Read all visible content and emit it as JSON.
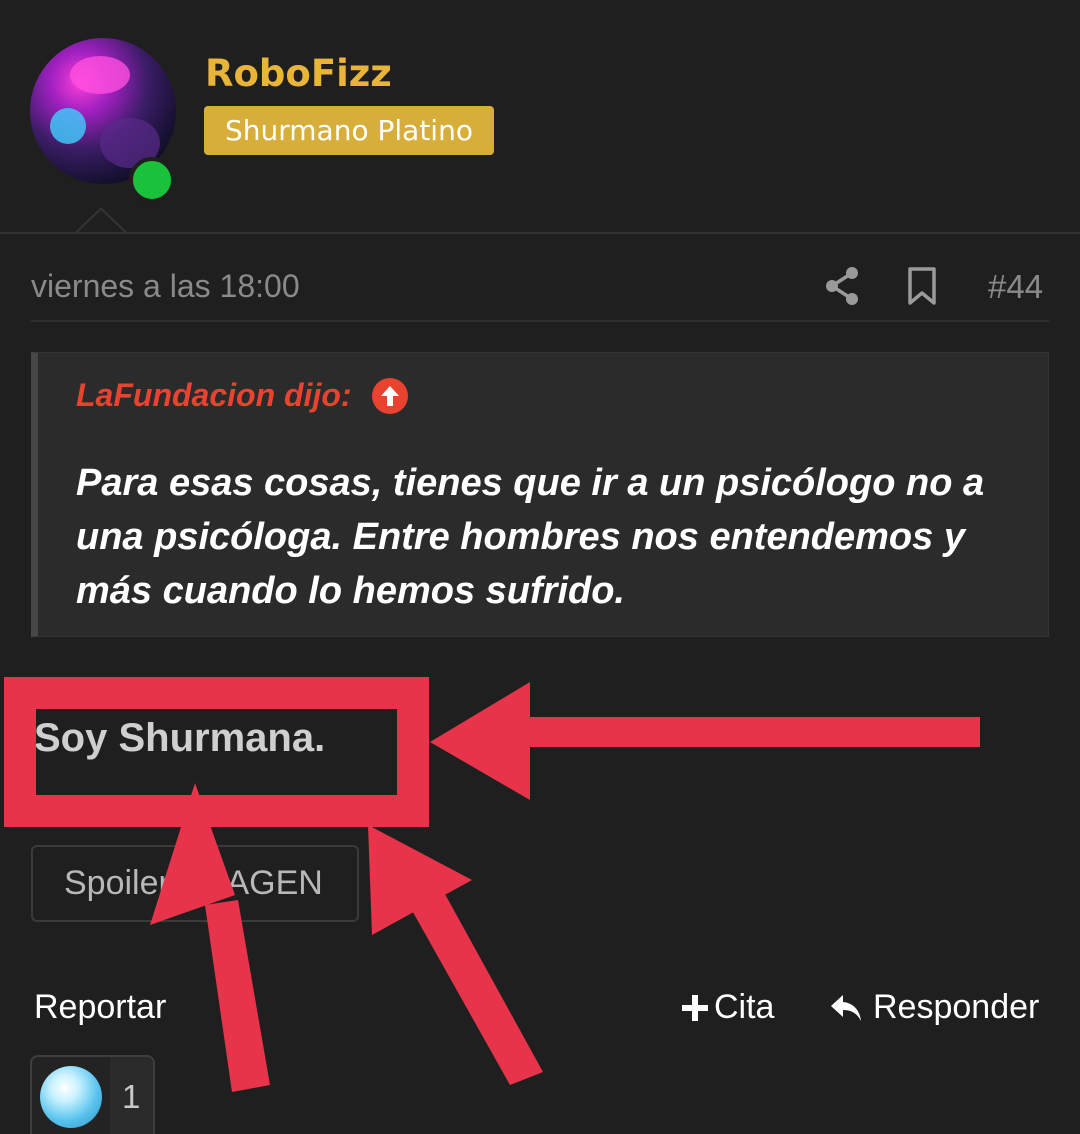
{
  "user": {
    "name": "RoboFizz",
    "rank": "Shurmano Platino",
    "status": "online"
  },
  "post": {
    "date": "viernes a las 18:00",
    "number": "#44",
    "body": "Soy Shurmana.",
    "spoiler_label": "Spoiler: IMAGEN"
  },
  "quote": {
    "author": "LaFundacion dijo:",
    "text": "Para esas cosas, tienes que ir a un psicólogo no a una psicóloga. Entre hombres nos entendemos y más cuando lo hemos sufrido."
  },
  "actions": {
    "report": "Reportar",
    "cite": "Cita",
    "reply": "Responder"
  },
  "reaction": {
    "icon": "diamond-icon",
    "count": "1"
  },
  "colors": {
    "background": "#1f1f1f",
    "username": "#e8b53a",
    "rank_badge": "#d7ae3a",
    "quote_author": "#e8432f",
    "online": "#19c23a",
    "annotation": "#e8344a"
  }
}
